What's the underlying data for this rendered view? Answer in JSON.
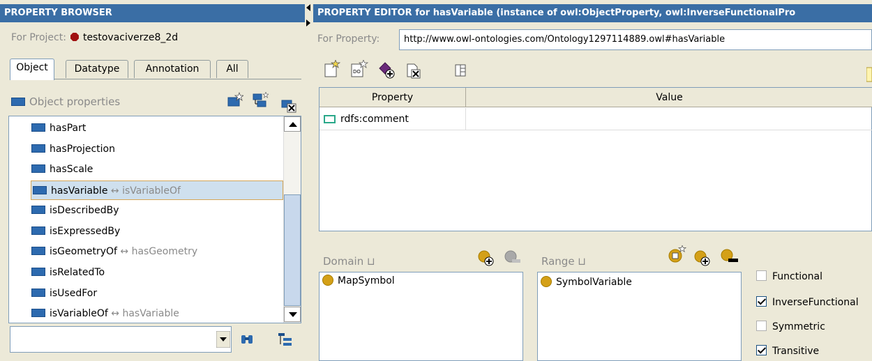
{
  "left_panel": {
    "title": "PROPERTY BROWSER",
    "for_project_label": "For Project:",
    "project_name": "testovaciverze8_2d",
    "tabs": [
      {
        "label": "Object",
        "active": true
      },
      {
        "label": "Datatype",
        "active": false
      },
      {
        "label": "Annotation",
        "active": false
      },
      {
        "label": "All",
        "active": false
      }
    ],
    "section_title": "Object properties",
    "items": [
      {
        "label": "hasPart",
        "inverse": ""
      },
      {
        "label": "hasProjection",
        "inverse": ""
      },
      {
        "label": "hasScale",
        "inverse": ""
      },
      {
        "label": "hasVariable",
        "inverse": "↔ isVariableOf",
        "selected": true
      },
      {
        "label": "isDescribedBy",
        "inverse": ""
      },
      {
        "label": "isExpressedBy",
        "inverse": ""
      },
      {
        "label": "isGeometryOf",
        "inverse": "↔ hasGeometry"
      },
      {
        "label": "isRelatedTo",
        "inverse": ""
      },
      {
        "label": "isUsedFor",
        "inverse": ""
      },
      {
        "label": "isVariableOf",
        "inverse": "↔ hasVariable"
      }
    ],
    "search_value": ""
  },
  "right_panel": {
    "title": "PROPERTY EDITOR for hasVariable   (instance of owl:ObjectProperty, owl:InverseFunctionalPro",
    "for_property_label": "For Property:",
    "property_uri": "http://www.owl-ontologies.com/Ontology1297114889.owl#hasVariable",
    "table": {
      "headers": [
        "Property",
        "Value"
      ],
      "rows": [
        {
          "property": "rdfs:comment",
          "value": ""
        }
      ]
    },
    "domain": {
      "label": "Domain ⊔",
      "items": [
        "MapSymbol"
      ]
    },
    "range": {
      "label": "Range ⊔",
      "items": [
        "SymbolVariable"
      ]
    },
    "characteristics": [
      {
        "label": "Functional",
        "checked": false
      },
      {
        "label": "InverseFunctional",
        "checked": true
      },
      {
        "label": "Symmetric",
        "checked": false
      },
      {
        "label": "Transitive",
        "checked": true
      }
    ]
  },
  "colors": {
    "title_bar": "#3a6ea5",
    "property_icon": "#2d6aaf",
    "class_dot": "#d4a017",
    "selection": "#cfe0ee"
  }
}
